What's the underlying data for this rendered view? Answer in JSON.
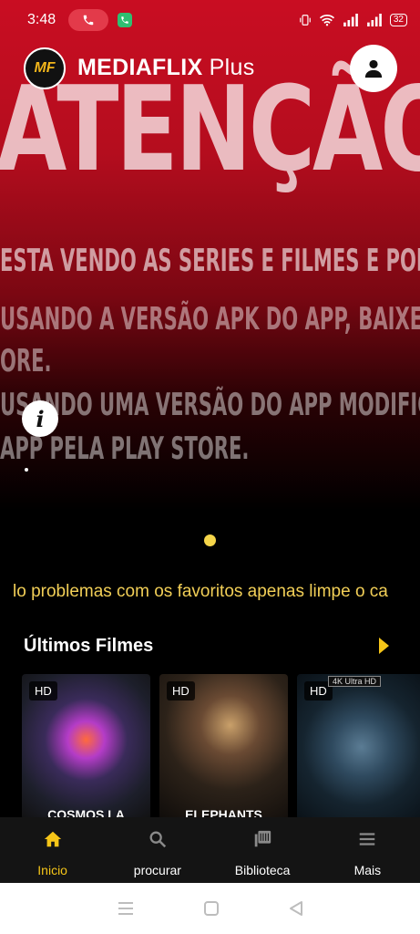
{
  "status_bar": {
    "time": "3:48",
    "battery": "32"
  },
  "header": {
    "logo_text": "MF",
    "app_name": "MEDIAFLIX",
    "app_suffix": "Plus"
  },
  "hero": {
    "headline": "ATENÇÃO",
    "lines": [
      "ESTA VENDO AS SERIES E FILMES E POR D",
      "USANDO A VERSÃO APK DO APP, BAIXE OU",
      "ORE.",
      "USANDO UMA VERSÃO DO APP MODIFICAD",
      "APP PELA PLAY STORE."
    ]
  },
  "marquee": {
    "text": "lo problemas com os favoritos apenas limpe o ca"
  },
  "section": {
    "title": "Últimos Filmes"
  },
  "posters": [
    {
      "badge": "HD",
      "title": "COSMOS LA"
    },
    {
      "badge": "HD",
      "title": "ELEPHANTS"
    },
    {
      "badge": "HD",
      "extra_badge": "4K Ultra HD",
      "title": ""
    }
  ],
  "bottom_nav": [
    {
      "label": "Inicio",
      "icon": "home-icon",
      "active": true
    },
    {
      "label": "procurar",
      "icon": "search-icon",
      "active": false
    },
    {
      "label": "Biblioteca",
      "icon": "library-icon",
      "active": false
    },
    {
      "label": "Mais",
      "icon": "menu-icon",
      "active": false
    }
  ],
  "colors": {
    "accent": "#f5c518",
    "hero_red": "#c90d22",
    "marquee": "#f2cf57"
  }
}
